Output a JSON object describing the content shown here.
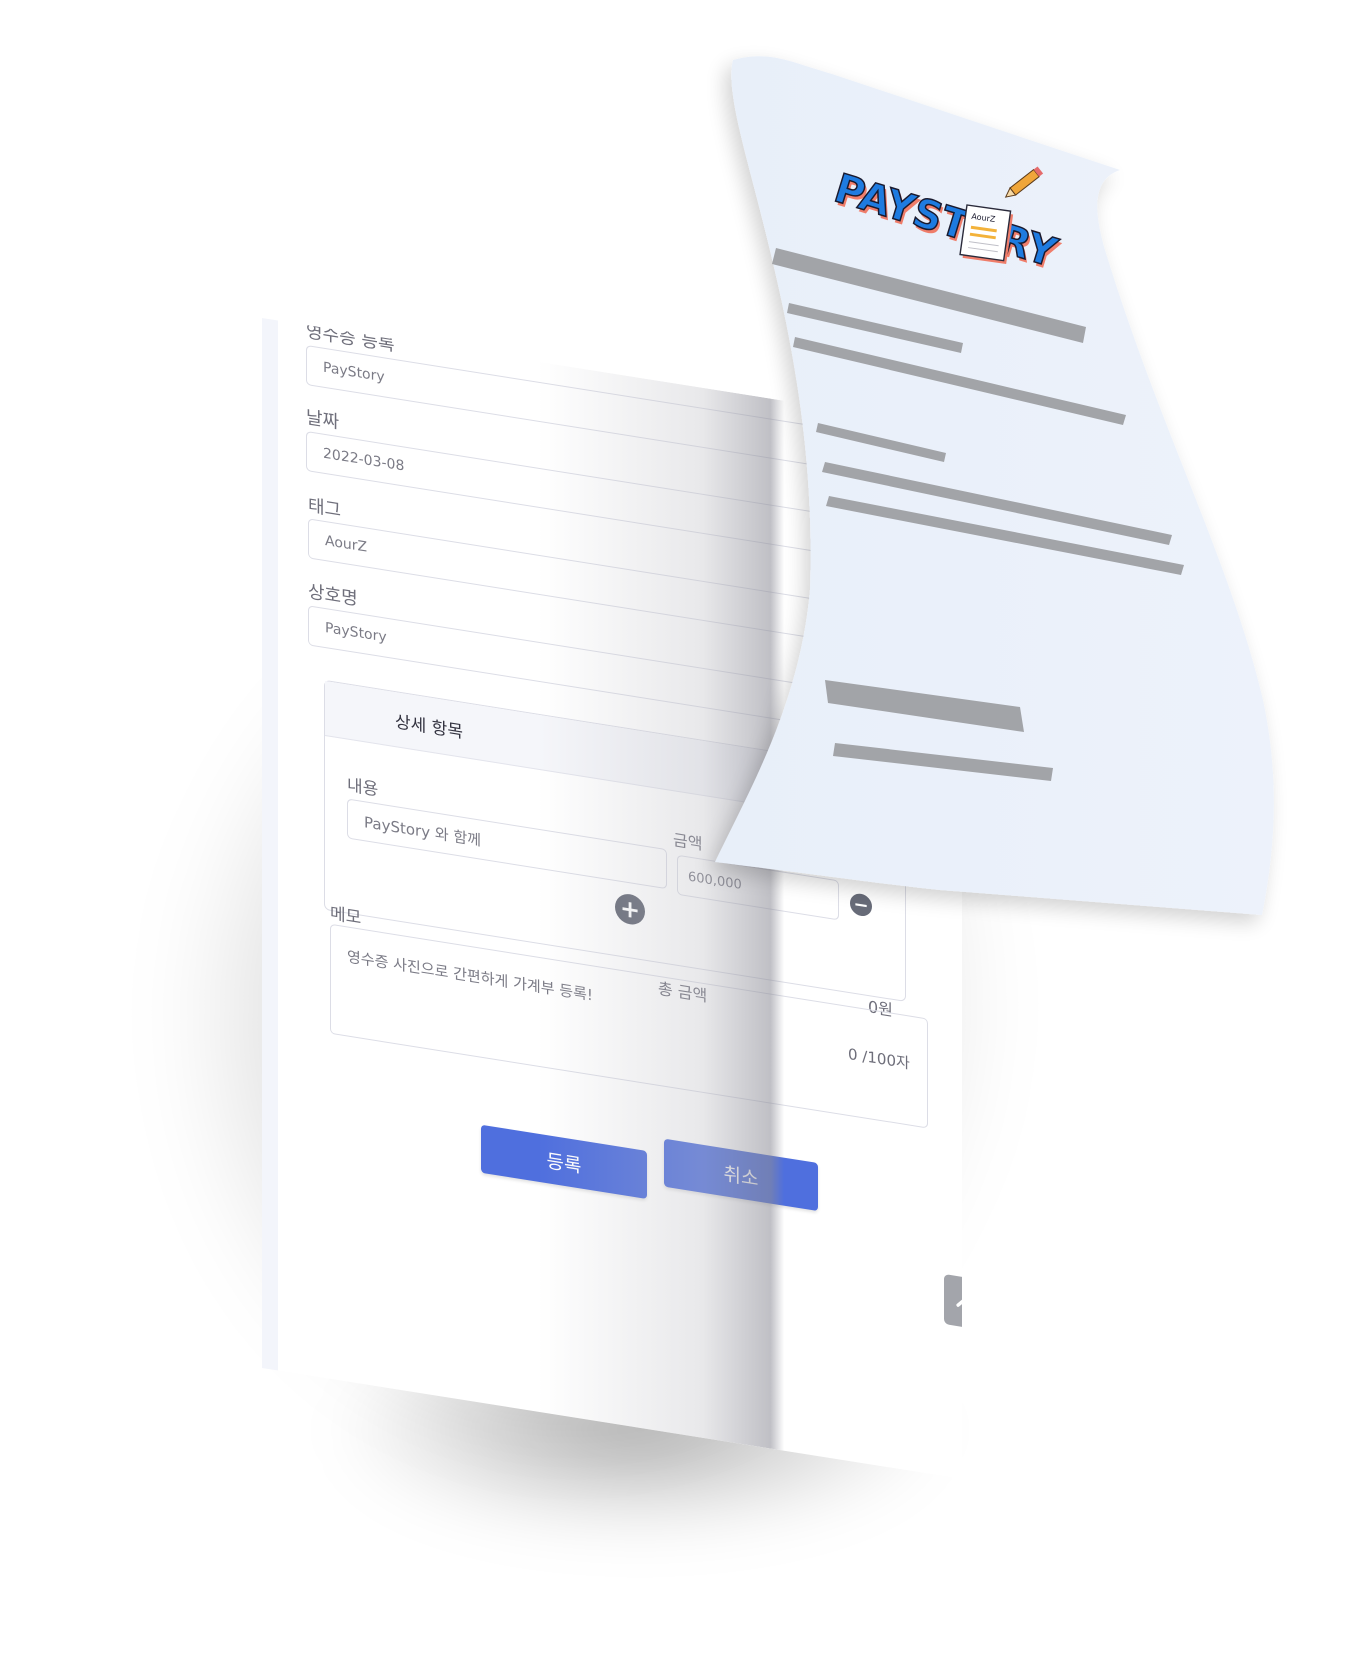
{
  "form": {
    "receipt_label": "영수증 등록",
    "receipt_value": "PayStory",
    "date_label": "날짜",
    "date_value": "2022-03-08",
    "tag_label": "태그",
    "tag_value": "AourZ",
    "store_label": "상호명",
    "store_value": "PayStory",
    "detail": {
      "title": "상세 항목",
      "content_label": "내용",
      "content_value": "PayStory 와 함께",
      "amount_label": "금액",
      "amount_value": "600,000"
    },
    "total_label": "총 금액",
    "total_value": "0원",
    "memo_label": "메모",
    "memo_counter": "0 /100자",
    "memo_value": "영수증 사진으로 간편하게 가계부 등록!",
    "submit_label": "등록",
    "cancel_label": "취소"
  },
  "icons": {
    "add": "plus-circle-icon",
    "remove": "minus-circle-icon",
    "scroll_top": "chevron-up-icon"
  },
  "logo": {
    "text": "PAYSTORY",
    "note_text": "AourZ"
  },
  "colors": {
    "primary_button": "#4f6fde",
    "paper": "#eaf1fb",
    "logo_blue": "#1e7be0",
    "logo_outline": "#1a1a2e",
    "logo_shadow": "#ef7d6a",
    "paper_lines": "#a2a4a8"
  }
}
